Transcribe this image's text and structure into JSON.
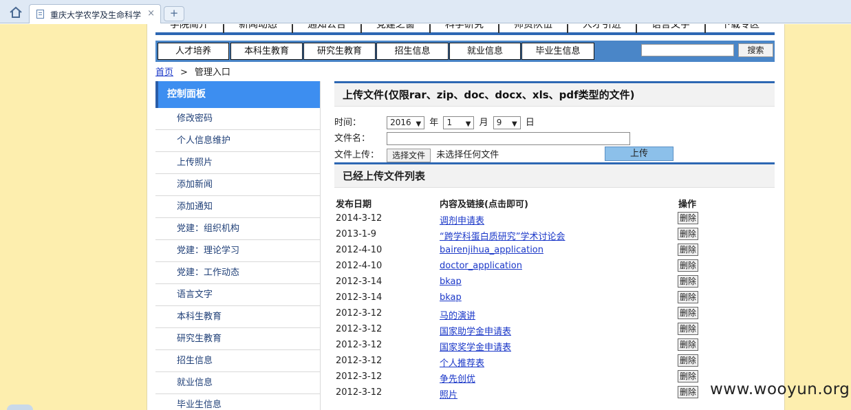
{
  "browser": {
    "tab_title": "重庆大学农学及生命科学",
    "close_glyph": "×",
    "newtab_glyph": "+"
  },
  "nav_top": [
    "学院简介",
    "新闻动态",
    "通知公告",
    "党建之窗",
    "科学研究",
    "师资队伍",
    "人才引进",
    "语言文字",
    "下载专区"
  ],
  "nav_second": [
    "人才培养",
    "本科生教育",
    "研究生教育",
    "招生信息",
    "就业信息",
    "毕业生信息"
  ],
  "search": {
    "button": "搜索",
    "value": ""
  },
  "breadcrumb": {
    "home": "首页",
    "sep": ">",
    "current": "管理入口"
  },
  "sidebar": {
    "title": "控制面板",
    "items": [
      "修改密码",
      "个人信息维护",
      "上传照片",
      "添加新闻",
      "添加通知",
      "党建：组织机构",
      "党建：理论学习",
      "党建：工作动态",
      "语言文字",
      "本科生教育",
      "研究生教育",
      "招生信息",
      "就业信息",
      "毕业生信息"
    ]
  },
  "upload": {
    "title": "上传文件(仅限rar、zip、doc、docx、xls、pdf类型的文件)",
    "time_label": "时间：",
    "year": "2016",
    "year_unit": "年",
    "month": "1",
    "month_unit": "月",
    "day": "9",
    "day_unit": "日",
    "filename_label": "文件名：",
    "file_label": "文件上传：",
    "choose_button": "选择文件",
    "no_file": "未选择任何文件",
    "upload_button": "上传"
  },
  "list": {
    "title": "已经上传文件列表",
    "headers": [
      "发布日期",
      "内容及链接(点击即可)",
      "操作"
    ],
    "delete_label": "删除",
    "rows": [
      {
        "date": "2014-3-12",
        "title": "调剂申请表"
      },
      {
        "date": "2013-1-9",
        "title": "“跨学科蛋白质研究”学术讨论会"
      },
      {
        "date": "2012-4-10",
        "title": "bairenjihua_application"
      },
      {
        "date": "2012-4-10",
        "title": "doctor_application"
      },
      {
        "date": "2012-3-14",
        "title": "bkap"
      },
      {
        "date": "2012-3-14",
        "title": "bkap"
      },
      {
        "date": "2012-3-12",
        "title": "马的演讲"
      },
      {
        "date": "2012-3-12",
        "title": "国家助学金申请表"
      },
      {
        "date": "2012-3-12",
        "title": "国家奖学金申请表"
      },
      {
        "date": "2012-3-12",
        "title": "个人推荐表"
      },
      {
        "date": "2012-3-12",
        "title": "争先创优"
      },
      {
        "date": "2012-3-12",
        "title": "照片"
      }
    ]
  },
  "watermark": "www.wooyun.org"
}
